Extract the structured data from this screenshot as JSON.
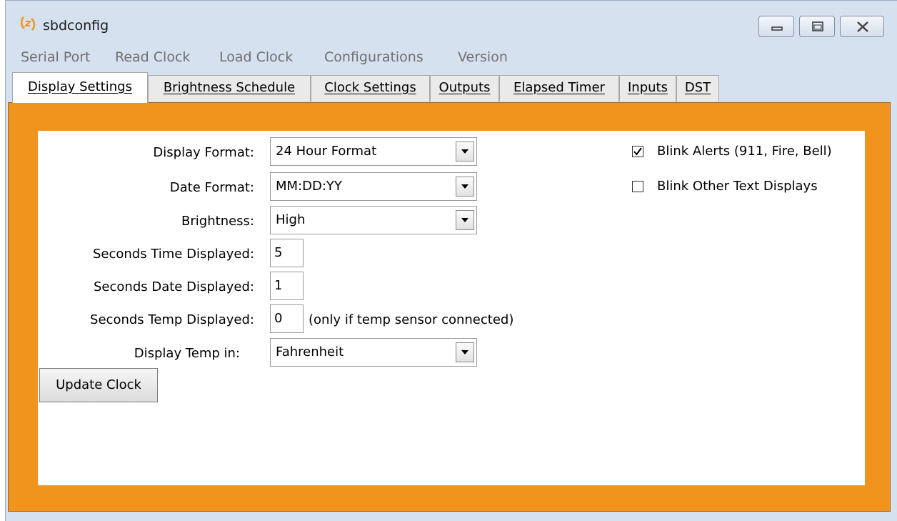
{
  "window": {
    "title": "sbdconfig",
    "icon": "sbd-logo-icon"
  },
  "menu": {
    "items": [
      "Serial Port",
      "Read Clock",
      "Load Clock",
      "Configurations",
      "Version"
    ]
  },
  "tabs": [
    {
      "label": "Display Settings",
      "active": true
    },
    {
      "label": "Brightness Schedule",
      "active": false
    },
    {
      "label": "Clock Settings",
      "active": false
    },
    {
      "label": "Outputs",
      "active": false
    },
    {
      "label": "Elapsed Timer",
      "active": false
    },
    {
      "label": "Inputs",
      "active": false
    },
    {
      "label": "DST",
      "active": false
    }
  ],
  "form": {
    "display_format": {
      "label": "Display Format:",
      "value": "24 Hour Format"
    },
    "date_format": {
      "label": "Date Format:",
      "value": "MM:DD:YY"
    },
    "brightness": {
      "label": "Brightness:",
      "value": "High"
    },
    "seconds_time": {
      "label": "Seconds Time Displayed:",
      "value": "5"
    },
    "seconds_date": {
      "label": "Seconds Date Displayed:",
      "value": "1"
    },
    "seconds_temp": {
      "label": "Seconds Temp Displayed:",
      "value": "0",
      "note": "(only if temp sensor connected)"
    },
    "temp_unit": {
      "label": "Display Temp in:",
      "value": "Fahrenheit"
    },
    "update_button": "Update Clock"
  },
  "options": {
    "blink_alerts": {
      "label": "Blink Alerts (911, Fire, Bell)",
      "checked": true
    },
    "blink_other": {
      "label": "Blink Other Text Displays",
      "checked": false
    }
  },
  "colors": {
    "panel_accent": "#f0941e",
    "window_frame": "#d6e1ef"
  }
}
